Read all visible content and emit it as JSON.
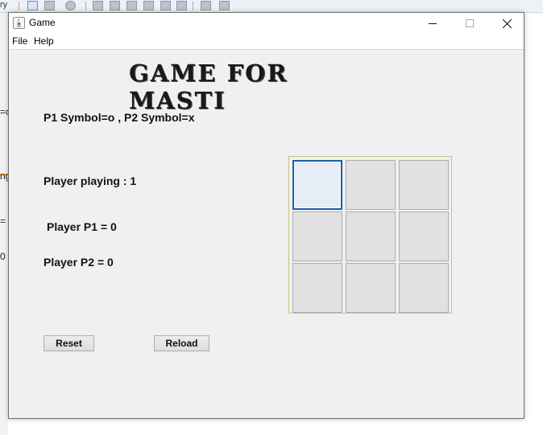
{
  "background": {
    "toolbar_fragment": "ry",
    "left_fragments": [
      "=c",
      "ng",
      "=",
      "0"
    ]
  },
  "window": {
    "title": "Game",
    "controls": {
      "minimize": "minimize-icon",
      "maximize": "maximize-icon",
      "close": "close-icon"
    }
  },
  "menu": {
    "file": "File",
    "help": "Help"
  },
  "main": {
    "title": "GAME FOR MASTI",
    "symbols": "P1 Symbol=o , P2 Symbol=x",
    "player_playing": "Player playing :  1",
    "player_p1": "Player P1 = 0",
    "player_p2": "Player P2 = 0"
  },
  "buttons": {
    "reset": "Reset",
    "reload": "Reload"
  },
  "board": {
    "cells": [
      "",
      "",
      "",
      "",
      "",
      "",
      "",
      "",
      ""
    ],
    "focused_cell": 0
  },
  "colors": {
    "board_border": "#c8c27a",
    "cell_bg": "#e1e1e1",
    "focus_border": "#1a5fa8"
  }
}
